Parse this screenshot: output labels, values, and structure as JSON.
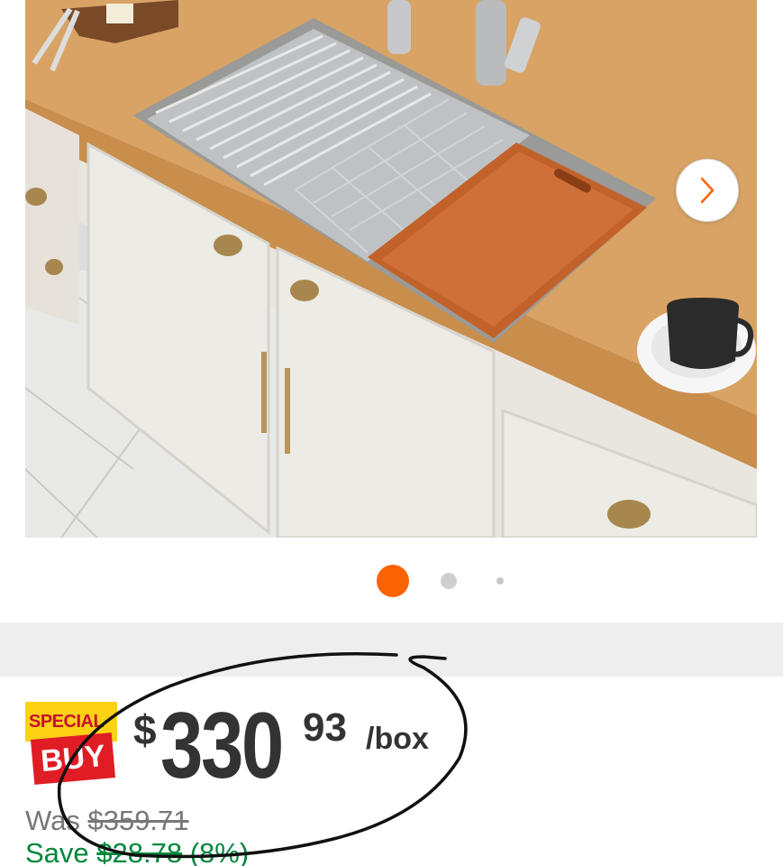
{
  "gallery": {
    "photo_alt": "Stainless steel workstation sink with cutting board",
    "next_icon": "chevron-right-icon",
    "dots": [
      {
        "active": true
      },
      {
        "active": false
      },
      {
        "active": false
      }
    ],
    "accent_color": "#f96302"
  },
  "badge": {
    "line1": "SPECIAL",
    "line2": "BUY"
  },
  "price": {
    "currency": "$",
    "dollars": "330",
    "cents": "93",
    "unit": "/box"
  },
  "was": {
    "label": "Was ",
    "amount": "$359.71"
  },
  "save": {
    "label": "Save ",
    "amount": "$28.78",
    "percent": " (8%)"
  },
  "colors": {
    "save_green": "#00873c",
    "badge_yellow": "#fcd116",
    "badge_red": "#e01c24"
  }
}
